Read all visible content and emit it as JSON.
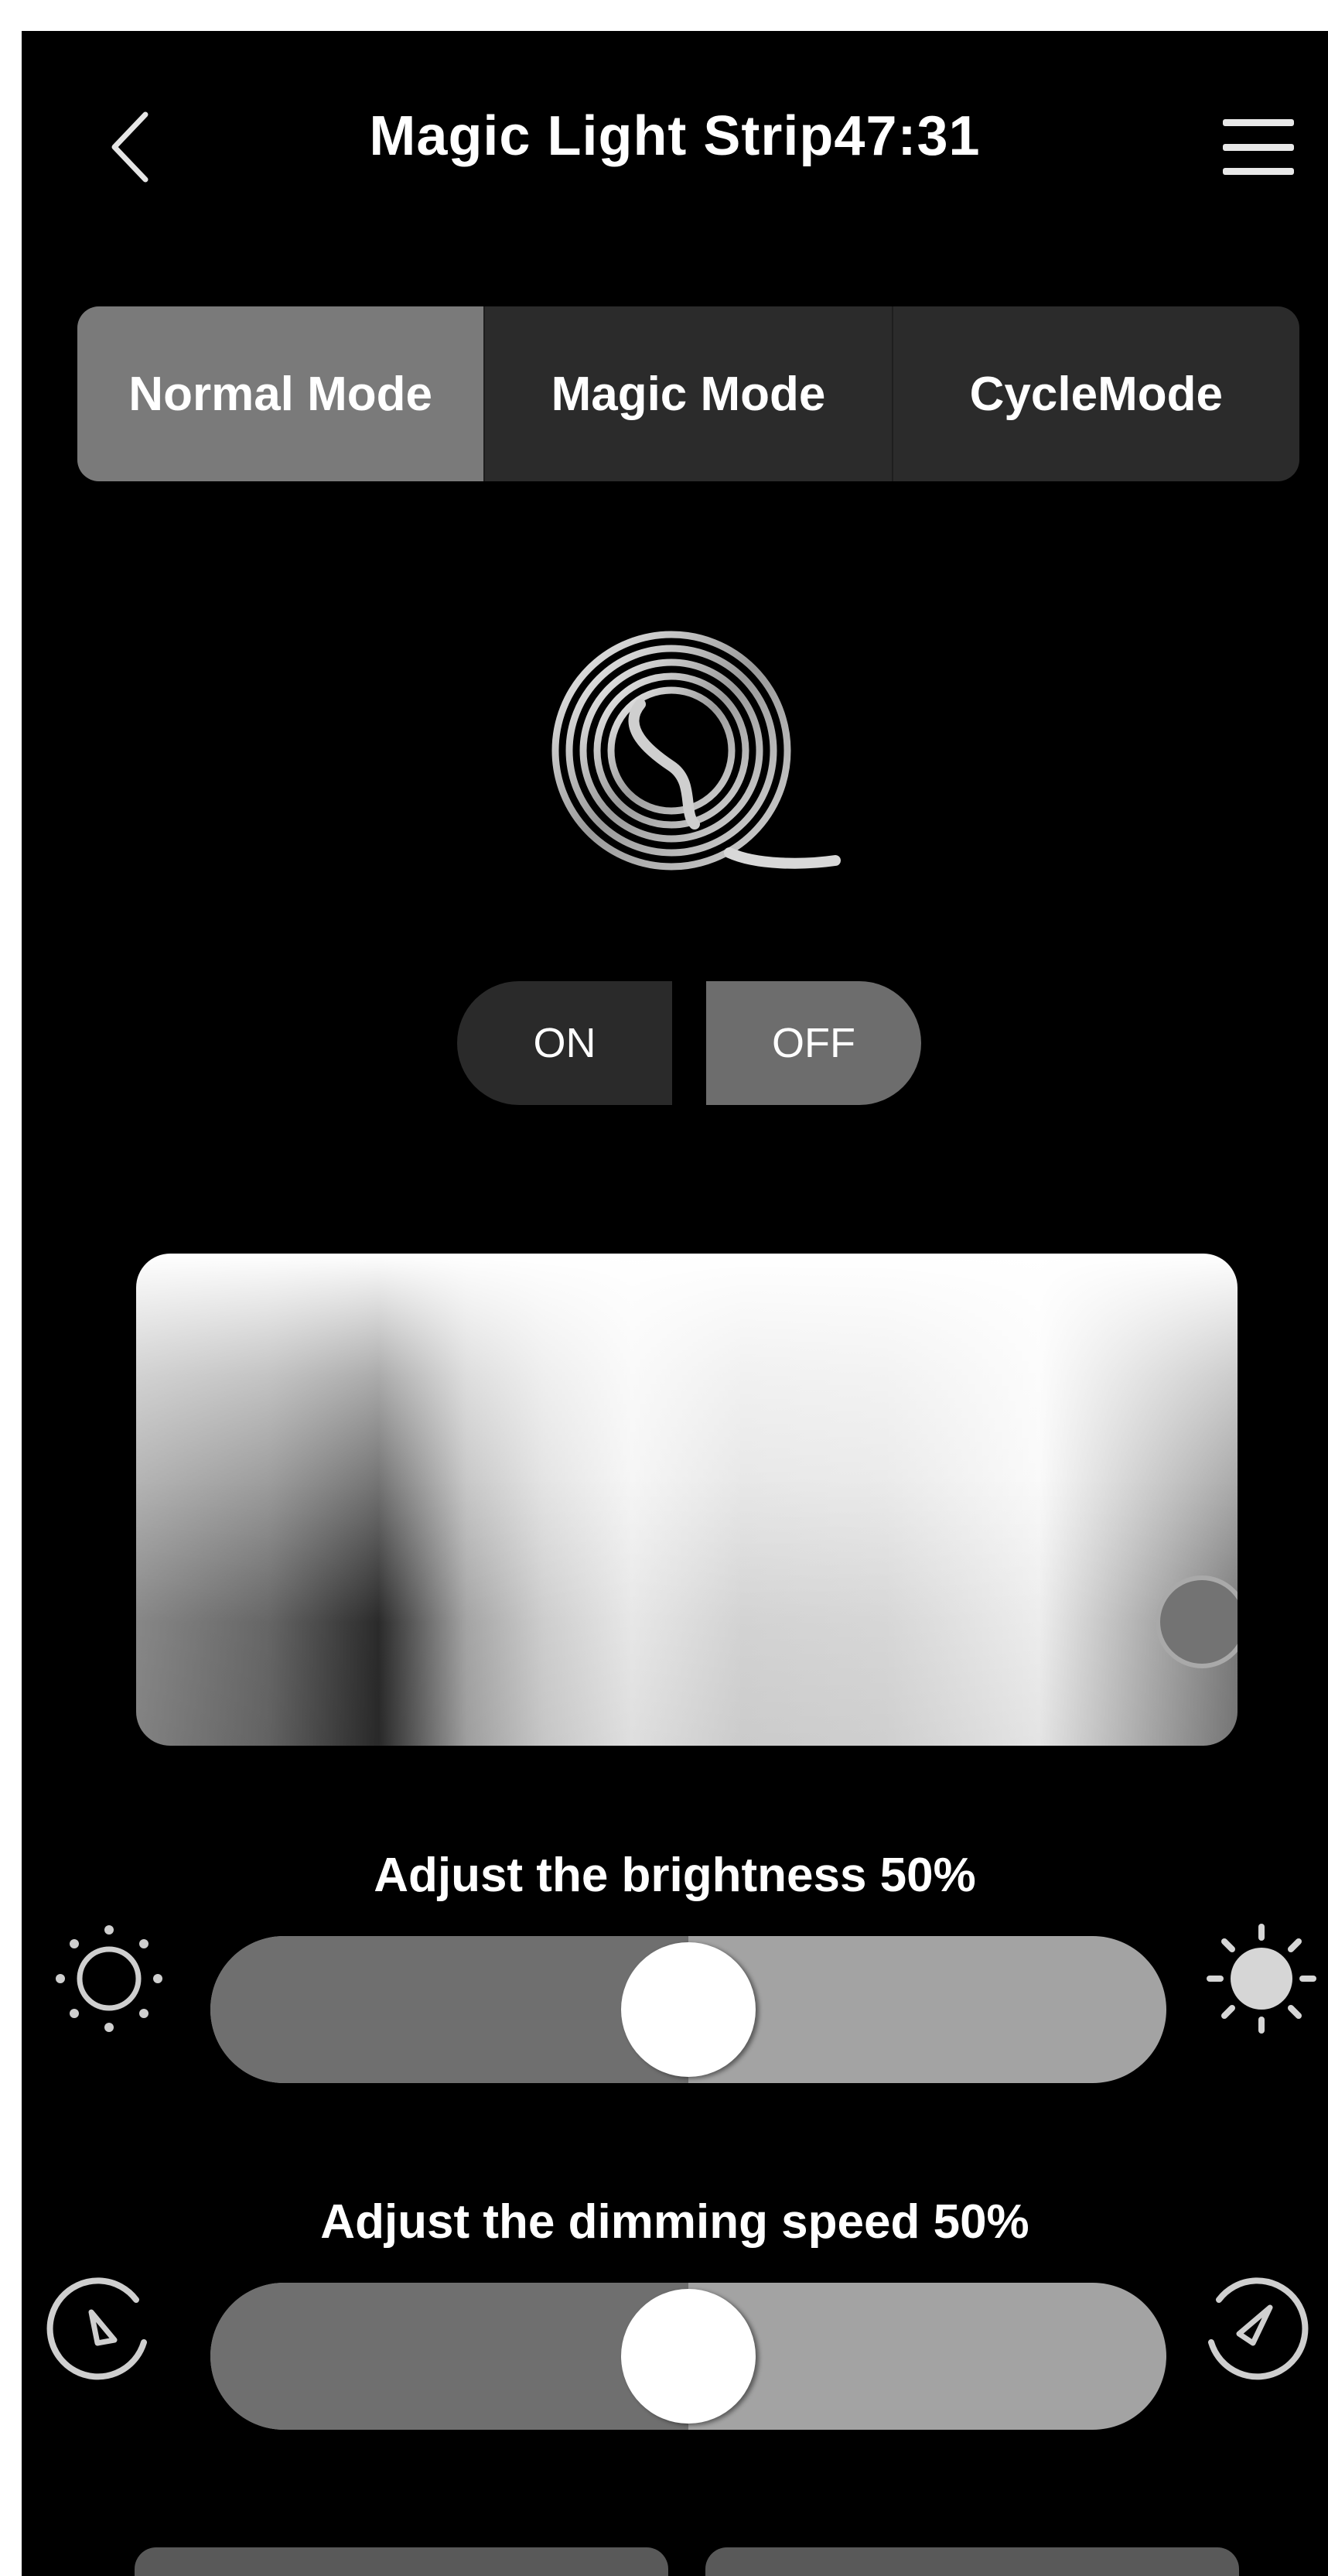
{
  "header": {
    "title": "Magic Light Strip47:31",
    "back_icon": "chevron-left-icon",
    "menu_icon": "hamburger-menu-icon"
  },
  "mode_tabs": [
    {
      "label": "Normal Mode",
      "active": true
    },
    {
      "label": "Magic Mode",
      "active": false
    },
    {
      "label": "CycleMode",
      "active": false
    }
  ],
  "device_icon": "light-strip-coil-icon",
  "power": {
    "on_label": "ON",
    "off_label": "OFF",
    "selected": "OFF"
  },
  "color_picker": {
    "icon": "color-spectrum-panel"
  },
  "brightness": {
    "label": "Adjust the brightness 50%",
    "value": 0.5,
    "min_icon": "sun-outline-icon",
    "max_icon": "sun-filled-icon"
  },
  "dimming_speed": {
    "label": "Adjust the dimming speed 50%",
    "value": 0.5,
    "min_icon": "speed-gauge-slow-icon",
    "max_icon": "speed-gauge-fast-icon"
  },
  "colors": {
    "background": "#000000",
    "tab_active": "#7a7a7a",
    "tab_inactive": "#2b2b2b",
    "track": "#a3a3a3",
    "track_fill": "#6f6f6f"
  }
}
